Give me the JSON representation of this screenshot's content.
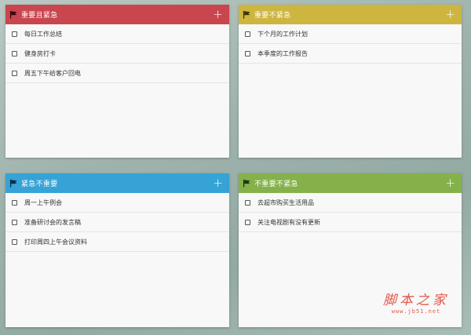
{
  "colors": {
    "urgent_important": "#c9464f",
    "important_not_urgent": "#cdb540",
    "urgent_not_important": "#35a3d6",
    "not_important_not_urgent": "#85b14b",
    "flag_dark": "#6b1118"
  },
  "icons": {
    "flag": "flag-icon",
    "add": "plus-icon",
    "checkbox": "checkbox"
  },
  "quadrants": {
    "tl": {
      "title": "重要且紧急",
      "add_label": "+",
      "tasks": [
        {
          "text": "每日工作总结"
        },
        {
          "text": "健身房打卡"
        },
        {
          "text": "周五下午给客户回电"
        }
      ]
    },
    "tr": {
      "title": "重要不紧急",
      "add_label": "+",
      "tasks": [
        {
          "text": "下个月的工作计划"
        },
        {
          "text": "本季度的工作报告"
        }
      ]
    },
    "bl": {
      "title": "紧急不重要",
      "add_label": "+",
      "tasks": [
        {
          "text": "周一上午例会"
        },
        {
          "text": "准备研讨会的发言稿"
        },
        {
          "text": "打印周四上午会议资料"
        }
      ]
    },
    "br": {
      "title": "不重要不紧急",
      "add_label": "+",
      "tasks": [
        {
          "text": "去超市购买生活用品"
        },
        {
          "text": "关注电视剧有没有更新"
        }
      ]
    }
  },
  "watermark": {
    "brand": "脚本之家",
    "url": "www.jb51.net"
  }
}
